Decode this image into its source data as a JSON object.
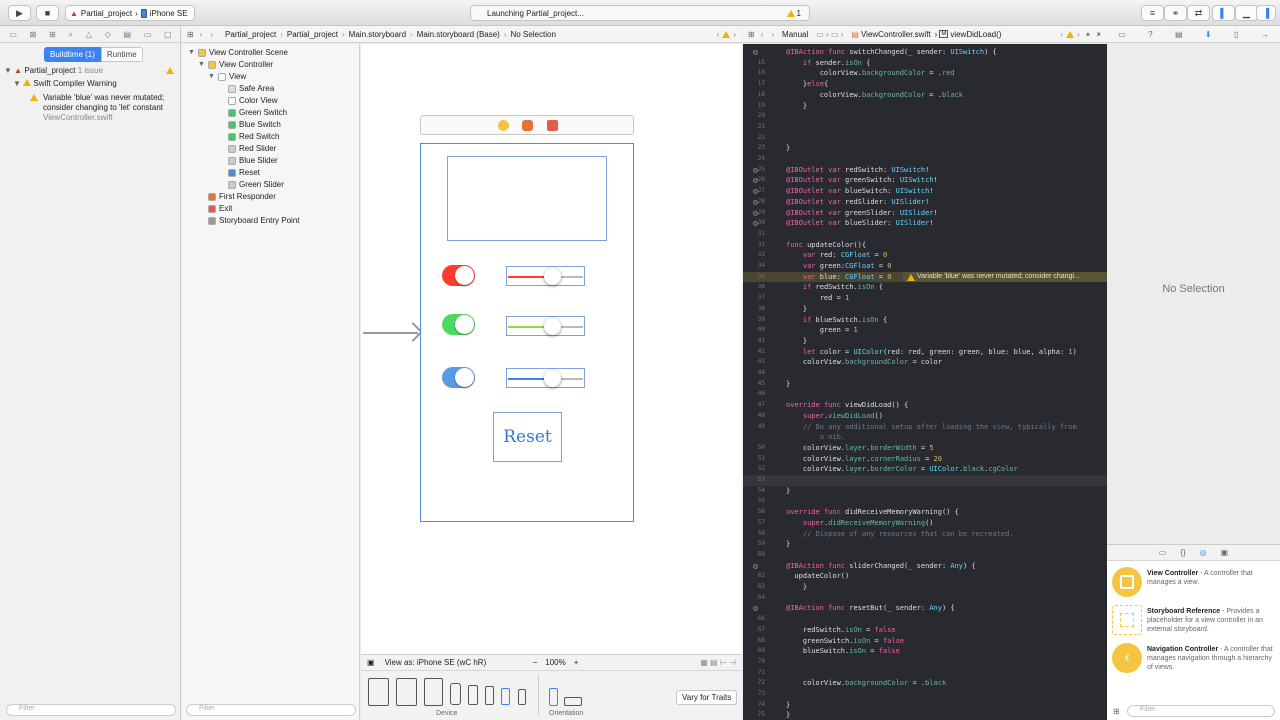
{
  "toolbar": {
    "scheme_project": "Partial_project",
    "scheme_device": "iPhone SE",
    "activity": "Launching Partial_project...",
    "warning_count": "1"
  },
  "navigator": {
    "seg_buildtime": "Buildtime (1)",
    "seg_runtime": "Runtime",
    "project": "Partial_project",
    "issue_count": "1 issue",
    "category": "Swift Compiler Warning",
    "warning_line1": "Variable 'blue' was never mutated;",
    "warning_line2": "consider changing to 'let' constant",
    "warning_file": "ViewController.swift",
    "filter_placeholder": "Filter"
  },
  "jumpbar": {
    "crumbs": [
      "Partial_project",
      "Partial_project",
      "Main.storyboard",
      "Main.storyboard (Base)",
      "No Selection"
    ]
  },
  "editor_jumpbar": {
    "mode": "Manual",
    "file": "ViewController.swift",
    "func": "viewDidLoad()"
  },
  "outline": {
    "items": [
      {
        "label": "View Controller Scene",
        "indent": 0,
        "icon": "#f5c542",
        "tri": "▼"
      },
      {
        "label": "View Controller",
        "indent": 1,
        "icon": "#f5c542",
        "tri": "▼"
      },
      {
        "label": "View",
        "indent": 2,
        "icon": "#ffffff",
        "tri": "▼"
      },
      {
        "label": "Safe Area",
        "indent": 3,
        "icon": "#dddddd",
        "tri": ""
      },
      {
        "label": "Color View",
        "indent": 3,
        "icon": "#ffffff",
        "tri": ""
      },
      {
        "label": "Green Switch",
        "indent": 3,
        "icon": "#44c767",
        "tri": ""
      },
      {
        "label": "Blue Switch",
        "indent": 3,
        "icon": "#44c767",
        "tri": ""
      },
      {
        "label": "Red Switch",
        "indent": 3,
        "icon": "#44c767",
        "tri": ""
      },
      {
        "label": "Red Slider",
        "indent": 3,
        "icon": "#cccccc",
        "tri": ""
      },
      {
        "label": "Blue Slider",
        "indent": 3,
        "icon": "#cccccc",
        "tri": ""
      },
      {
        "label": "Reset",
        "indent": 3,
        "icon": "#4a89dc",
        "tri": ""
      },
      {
        "label": "Green Slider",
        "indent": 3,
        "icon": "#cccccc",
        "tri": ""
      },
      {
        "label": "First Responder",
        "indent": 1,
        "icon": "#e8703a",
        "tri": ""
      },
      {
        "label": "Exit",
        "indent": 1,
        "icon": "#e35b4b",
        "tri": ""
      },
      {
        "label": "Storyboard Entry Point",
        "indent": 1,
        "icon": "#999999",
        "tri": ""
      }
    ],
    "filter_placeholder": "Filter"
  },
  "canvas": {
    "reset_label": "Reset",
    "view_as": "View as: iPhone SE (wC hR)",
    "zoom": "100%",
    "vary": "Vary for Traits",
    "device_label": "Device",
    "orientation_label": "Orientation"
  },
  "code": {
    "lines": [
      {
        "n": "",
        "t": "<span class='kw'>@IBAction</span> <span class='kw'>func</span> switchChanged(_ sender: <span class='ty'>UISwitch</span>) {",
        "bp": true
      },
      {
        "n": "15",
        "t": "    <span class='kw'>if</span> sender.<span class='fn'>isOn</span> {"
      },
      {
        "n": "16",
        "t": "        colorView.<span class='fn'>backgroundColor</span> = .<span class='fn'>red</span>"
      },
      {
        "n": "17",
        "t": "    }<span class='kw'>else</span>{"
      },
      {
        "n": "18",
        "t": "        colorView.<span class='fn'>backgroundColor</span> = .<span class='fn'>black</span>"
      },
      {
        "n": "19",
        "t": "    }"
      },
      {
        "n": "20",
        "t": ""
      },
      {
        "n": "21",
        "t": ""
      },
      {
        "n": "22",
        "t": ""
      },
      {
        "n": "23",
        "t": "}"
      },
      {
        "n": "24",
        "t": ""
      },
      {
        "n": "25",
        "t": "<span class='kw'>@IBOutlet</span> <span class='kw'>var</span> redSwitch: <span class='ty'>UISwitch</span>!",
        "bp": true
      },
      {
        "n": "26",
        "t": "<span class='kw'>@IBOutlet</span> <span class='kw'>var</span> greenSwitch: <span class='ty'>UISwitch</span>!",
        "bp": true
      },
      {
        "n": "27",
        "t": "<span class='kw'>@IBOutlet</span> <span class='kw'>var</span> blueSwitch: <span class='ty'>UISwitch</span>!",
        "bp": true
      },
      {
        "n": "28",
        "t": "<span class='kw'>@IBOutlet</span> <span class='kw'>var</span> redSlider: <span class='ty'>UISlider</span>!",
        "bp": true
      },
      {
        "n": "29",
        "t": "<span class='kw'>@IBOutlet</span> <span class='kw'>var</span> greenSlider: <span class='ty'>UISlider</span>!",
        "bp": true
      },
      {
        "n": "30",
        "t": "<span class='kw'>@IBOutlet</span> <span class='kw'>var</span> blueSlider: <span class='ty'>UISlider</span>!",
        "bp": true
      },
      {
        "n": "31",
        "t": ""
      },
      {
        "n": "32",
        "t": "<span class='kw'>func</span> updateColor(){"
      },
      {
        "n": "33",
        "t": "    <span class='kw'>var</span> red: <span class='ty'>CGFloat</span> = <span class='nu'>0</span>"
      },
      {
        "n": "34",
        "t": "    <span class='kw'>var</span> green:<span class='ty'>CGFloat</span> = <span class='nu'>0</span>"
      },
      {
        "n": "35",
        "t": "    <span class='kw'>var</span> blue: <span class='ty'>CGFloat</span> = <span class='nu'>0</span>",
        "warn": true
      },
      {
        "n": "36",
        "t": "    <span class='kw'>if</span> redSwitch.<span class='fn'>isOn</span> {"
      },
      {
        "n": "37",
        "t": "        red = <span class='nu'>1</span>"
      },
      {
        "n": "38",
        "t": "    }"
      },
      {
        "n": "39",
        "t": "    <span class='kw'>if</span> blueSwitch.<span class='fn'>isOn</span> {"
      },
      {
        "n": "40",
        "t": "        green = <span class='nu'>1</span>"
      },
      {
        "n": "41",
        "t": "    }"
      },
      {
        "n": "42",
        "t": "    <span class='kw'>let</span> color = <span class='ty'>UIColor</span>(red: red, green: green, blue: blue, alpha: <span class='nu'>1</span>)"
      },
      {
        "n": "43",
        "t": "    colorView.<span class='fn'>backgroundColor</span> = color"
      },
      {
        "n": "44",
        "t": ""
      },
      {
        "n": "45",
        "t": "}"
      },
      {
        "n": "46",
        "t": ""
      },
      {
        "n": "47",
        "t": "<span class='kw'>override</span> <span class='kw'>func</span> viewDidLoad() {"
      },
      {
        "n": "48",
        "t": "    <span class='kw'>super</span>.<span class='fn'>viewDidLoad</span>()"
      },
      {
        "n": "49",
        "t": "    <span class='cm'>// Do any additional setup after loading the view, typically from</span>"
      },
      {
        "n": "",
        "t": "        <span class='cm'>a nib.</span>"
      },
      {
        "n": "50",
        "t": "    colorView.<span class='fn'>layer</span>.<span class='fn'>borderWidth</span> = <span class='nu'>5</span>"
      },
      {
        "n": "51",
        "t": "    colorView.<span class='fn'>layer</span>.<span class='fn'>cornerRadius</span> = <span class='nu'>20</span>"
      },
      {
        "n": "52",
        "t": "    colorView.<span class='fn'>layer</span>.<span class='fn'>borderColor</span> = <span class='ty'>UIColor</span>.<span class='fn'>black</span>.<span class='fn'>cgColor</span>"
      },
      {
        "n": "53",
        "t": "",
        "cur": true
      },
      {
        "n": "54",
        "t": "}"
      },
      {
        "n": "55",
        "t": ""
      },
      {
        "n": "56",
        "t": "<span class='kw'>override</span> <span class='kw'>func</span> didReceiveMemoryWarning() {"
      },
      {
        "n": "57",
        "t": "    <span class='kw'>super</span>.<span class='fn'>didReceiveMemoryWarning</span>()"
      },
      {
        "n": "58",
        "t": "    <span class='cm'>// Dispose of any resources that can be recreated.</span>"
      },
      {
        "n": "59",
        "t": "}"
      },
      {
        "n": "60",
        "t": ""
      },
      {
        "n": "",
        "t": "<span class='kw'>@IBAction</span> <span class='kw'>func</span> sliderChanged(_ sender: <span class='ty'>Any</span>) {",
        "bp": true
      },
      {
        "n": "62",
        "t": "  updateColor()"
      },
      {
        "n": "63",
        "t": "    }"
      },
      {
        "n": "64",
        "t": ""
      },
      {
        "n": "",
        "t": "<span class='kw'>@IBAction</span> <span class='kw'>func</span> resetBut(_ sender: <span class='ty'>Any</span>) {",
        "bp": true
      },
      {
        "n": "66",
        "t": ""
      },
      {
        "n": "67",
        "t": "    redSwitch.<span class='fn'>isOn</span> = <span class='kw'>false</span>"
      },
      {
        "n": "68",
        "t": "    greenSwitch.<span class='fn'>isOn</span> = <span class='kw'>false</span>"
      },
      {
        "n": "69",
        "t": "    blueSwitch.<span class='fn'>isOn</span> = <span class='kw'>false</span>"
      },
      {
        "n": "70",
        "t": ""
      },
      {
        "n": "71",
        "t": ""
      },
      {
        "n": "72",
        "t": "    colorView.<span class='fn'>backgroundColor</span> = .<span class='fn'>black</span>"
      },
      {
        "n": "73",
        "t": ""
      },
      {
        "n": "74",
        "t": "}"
      },
      {
        "n": "75",
        "t": "}"
      }
    ],
    "warning_text": "Variable 'blue' was never mutated; consider changi..."
  },
  "inspector": {
    "no_selection": "No Selection"
  },
  "library": {
    "items": [
      {
        "title": "View Controller",
        "desc": " - A controller that manages a view.",
        "color": "#f5c542"
      },
      {
        "title": "Storyboard Reference",
        "desc": " - Provides a placeholder for a view controller in an external storyboard.",
        "color": "#f5c542"
      },
      {
        "title": "Navigation Controller",
        "desc": " - A controller that manages navigation through a hierarchy of views.",
        "color": "#f5c542"
      }
    ],
    "filter_placeholder": "Filter"
  },
  "colors": {
    "accent": "#3b83f0",
    "switch_red": "#ff3b30",
    "switch_green": "#4cd964",
    "switch_blue": "#5b9be6",
    "code_bg": "#292a30"
  }
}
